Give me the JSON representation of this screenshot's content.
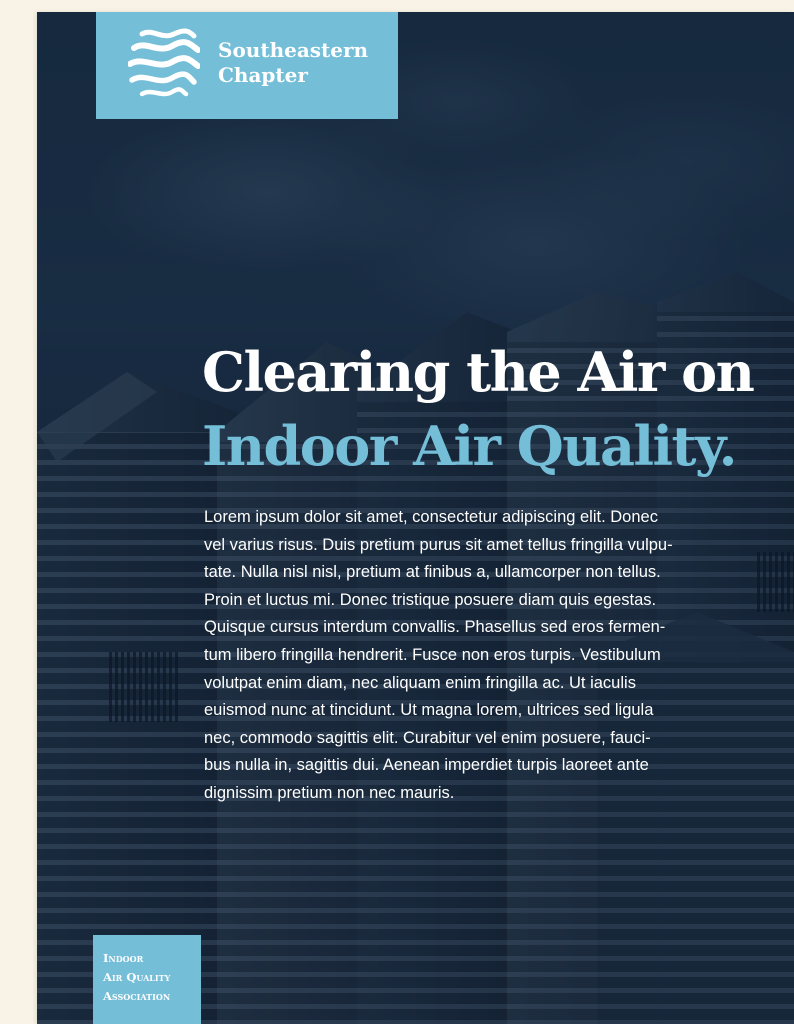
{
  "brand": {
    "chapter_line1": "Southeastern",
    "chapter_line2": "Chapter",
    "logo_icon": "air-waves-icon"
  },
  "headline": {
    "line1": "Clearing the Air on",
    "line2": "Indoor Air Quality."
  },
  "body": {
    "lines": [
      "Lorem ipsum dolor sit amet, consectetur adipiscing elit. Donec",
      "vel varius risus. Duis pretium purus sit amet tellus fringilla vulpu-",
      "tate. Nulla nisl nisl, pretium at finibus a, ullamcorper non tellus.",
      "Proin et luctus mi. Donec tristique posuere diam quis egestas.",
      "Quisque cursus interdum convallis. Phasellus sed eros fermen-",
      "tum libero fringilla hendrerit. Fusce non eros turpis. Vestibulum",
      "volutpat enim diam, nec aliquam enim fringilla ac. Ut iaculis",
      "euismod nunc at tincidunt. Ut magna lorem, ultrices sed ligula",
      "nec, commodo sagittis elit. Curabitur vel enim posuere, fauci-",
      "bus nulla in, sagittis dui. Aenean imperdiet turpis laoreet ante",
      "dignissim pretium non nec mauris."
    ]
  },
  "association": {
    "line1": "Indoor",
    "line2": "Air Quality",
    "line3": "Association"
  },
  "colors": {
    "accent": "#74bed8",
    "background": "#1b324a",
    "text": "#ffffff",
    "margin": "#f8f3e6"
  }
}
